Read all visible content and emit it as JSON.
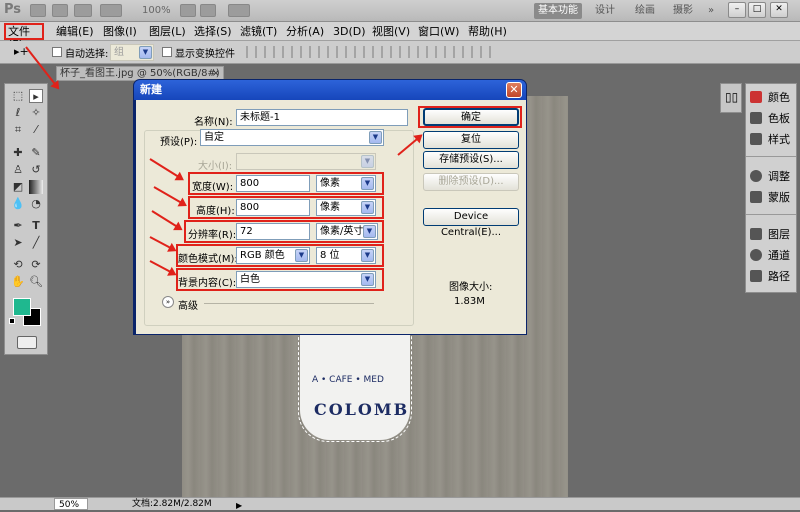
{
  "appbar": {
    "logo": "Ps",
    "zoom": "100%",
    "workspaces": [
      "基本功能",
      "设计",
      "绘画",
      "摄影"
    ],
    "more": "»"
  },
  "menu": [
    "文件(F)",
    "编辑(E)",
    "图像(I)",
    "图层(L)",
    "选择(S)",
    "滤镜(T)",
    "分析(A)",
    "3D(D)",
    "视图(V)",
    "窗口(W)",
    "帮助(H)"
  ],
  "options": {
    "auto_select_label": "自动选择:",
    "auto_select_value": "组",
    "show_transform_label": "显示变换控件"
  },
  "document": {
    "tab_title": "杯子_看图王.jpg @ 50%(RGB/8#)",
    "tab_close": "×",
    "mug_text": "COLOMB",
    "mug_band": "A • CAFE • MED"
  },
  "status": {
    "zoom": "50%",
    "doc_info": "文档:2.82M/2.82M"
  },
  "panels": {
    "group1": [
      {
        "label": "颜色",
        "icon": "color-icon"
      },
      {
        "label": "色板",
        "icon": "swatches-icon"
      },
      {
        "label": "样式",
        "icon": "styles-icon"
      }
    ],
    "group2": [
      {
        "label": "调整",
        "icon": "adjustments-icon"
      },
      {
        "label": "蒙版",
        "icon": "masks-icon"
      }
    ],
    "group3": [
      {
        "label": "图层",
        "icon": "layers-icon"
      },
      {
        "label": "通道",
        "icon": "channels-icon"
      },
      {
        "label": "路径",
        "icon": "paths-icon"
      }
    ]
  },
  "colors": {
    "foreground": "#1fb88f",
    "background": "#000000",
    "highlight": "#e0221a"
  },
  "dialog": {
    "title": "新建",
    "close": "✕",
    "name_label": "名称(N):",
    "name_value": "未标题-1",
    "preset_label": "预设(P):",
    "preset_value": "自定",
    "size_label": "大小(I):",
    "width_label": "宽度(W):",
    "width_value": "800",
    "width_unit": "像素",
    "height_label": "高度(H):",
    "height_value": "800",
    "height_unit": "像素",
    "resolution_label": "分辨率(R):",
    "resolution_value": "72",
    "resolution_unit": "像素/英寸",
    "color_mode_label": "颜色模式(M):",
    "color_mode_value": "RGB 颜色",
    "bit_depth_value": "8 位",
    "background_label": "背景内容(C):",
    "background_value": "白色",
    "advanced_label": "高级",
    "ok_button": "确定",
    "reset_button": "复位",
    "save_preset_button": "存储预设(S)...",
    "delete_preset_button": "删除预设(D)...",
    "device_central_button": "Device Central(E)...",
    "image_size_label": "图像大小:",
    "image_size_value": "1.83M"
  }
}
